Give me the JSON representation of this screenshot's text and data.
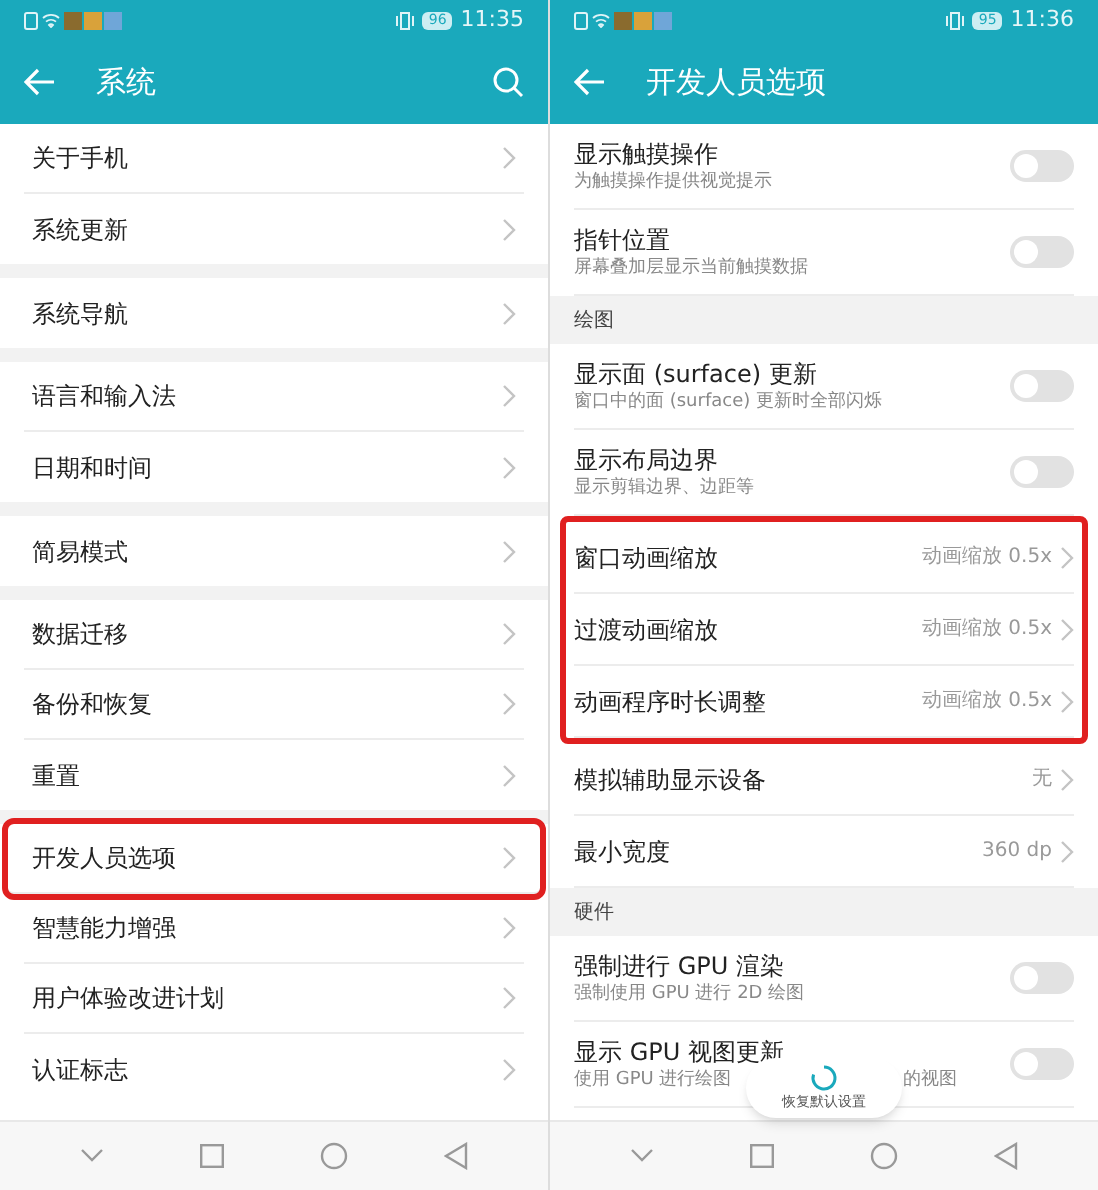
{
  "left": {
    "status": {
      "battery": "96",
      "time": "11:35"
    },
    "title": "系统",
    "groups": [
      [
        {
          "label": "关于手机",
          "highlighted": false
        },
        {
          "label": "系统更新",
          "highlighted": false
        }
      ],
      [
        {
          "label": "系统导航",
          "highlighted": false
        }
      ],
      [
        {
          "label": "语言和输入法",
          "highlighted": false
        },
        {
          "label": "日期和时间",
          "highlighted": false
        }
      ],
      [
        {
          "label": "简易模式",
          "highlighted": false
        }
      ],
      [
        {
          "label": "数据迁移",
          "highlighted": false
        },
        {
          "label": "备份和恢复",
          "highlighted": false
        },
        {
          "label": "重置",
          "highlighted": false
        }
      ],
      [
        {
          "label": "开发人员选项",
          "highlighted": true
        },
        {
          "label": "智慧能力增强",
          "highlighted": false
        },
        {
          "label": "用户体验改进计划",
          "highlighted": false
        },
        {
          "label": "认证标志",
          "highlighted": false
        }
      ]
    ]
  },
  "right": {
    "status": {
      "battery": "95",
      "time": "11:36"
    },
    "title": "开发人员选项",
    "items": [
      {
        "kind": "toggle",
        "title": "显示触摸操作",
        "subtitle": "为触摸操作提供视觉提示",
        "on": false
      },
      {
        "kind": "toggle",
        "title": "指针位置",
        "subtitle": "屏幕叠加层显示当前触摸数据",
        "on": false
      },
      {
        "kind": "header",
        "title": "绘图"
      },
      {
        "kind": "toggle",
        "title": "显示面 (surface) 更新",
        "subtitle": "窗口中的面 (surface) 更新时全部闪烁",
        "on": false
      },
      {
        "kind": "toggle",
        "title": "显示布局边界",
        "subtitle": "显示剪辑边界、边距等",
        "on": false
      },
      {
        "kind": "frame",
        "items": [
          {
            "kind": "value",
            "title": "窗口动画缩放",
            "value": "动画缩放 0.5x"
          },
          {
            "kind": "value",
            "title": "过渡动画缩放",
            "value": "动画缩放 0.5x"
          },
          {
            "kind": "value",
            "title": "动画程序时长调整",
            "value": "动画缩放 0.5x"
          }
        ]
      },
      {
        "kind": "value",
        "title": "模拟辅助显示设备",
        "value": "无"
      },
      {
        "kind": "value",
        "title": "最小宽度",
        "value": "360 dp"
      },
      {
        "kind": "header",
        "title": "硬件"
      },
      {
        "kind": "toggle",
        "title": "强制进行 GPU 渲染",
        "subtitle": "强制使用 GPU 进行 2D 绘图",
        "on": false
      },
      {
        "kind": "toggle",
        "title": "显示 GPU 视图更新",
        "subtitle_parts": [
          "使用 GPU 进行绘图",
          "的视图"
        ],
        "on": false
      }
    ],
    "toast": "恢复默认设置"
  }
}
